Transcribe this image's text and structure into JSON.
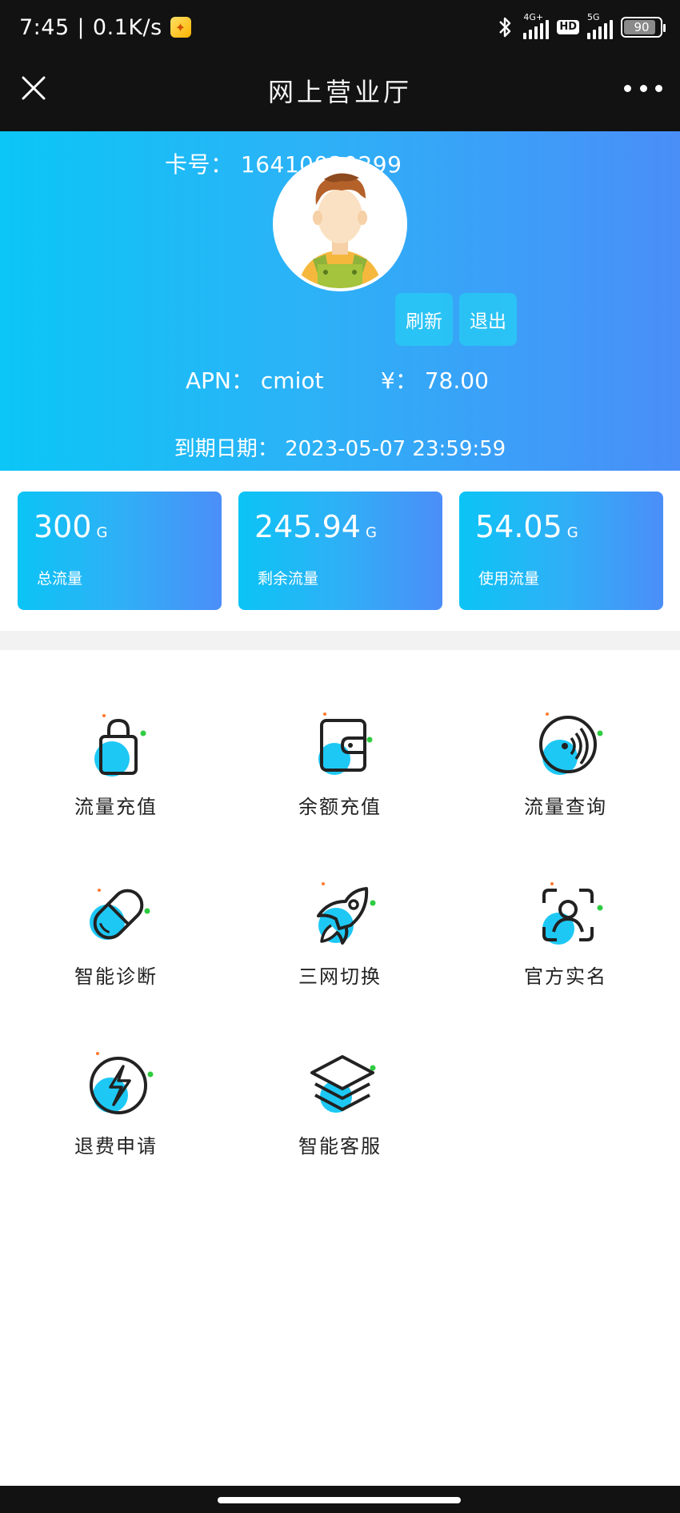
{
  "status_bar": {
    "time": "7:45",
    "speed": "0.1K/s",
    "network_1": "4G+",
    "network_2": "5G",
    "hd": "HD",
    "battery": "90",
    "battery_level": 0.9
  },
  "header": {
    "title": "网上营业厅",
    "close_icon": "close-icon",
    "more_icon": "more-icon"
  },
  "profile": {
    "card_label": "卡号：",
    "card_number": "16410030299",
    "refresh_label": "刷新",
    "logout_label": "退出",
    "apn_label": "APN：",
    "apn_value": "cmiot",
    "balance_label": "¥：",
    "balance_value": "78.00",
    "expire_label": "到期日期：",
    "expire_value": "2023-05-07 23:59:59"
  },
  "stats": [
    {
      "value": "300",
      "unit": "G",
      "label": "总流量"
    },
    {
      "value": "245.94",
      "unit": "G",
      "label": "剩余流量"
    },
    {
      "value": "54.05",
      "unit": "G",
      "label": "使用流量"
    }
  ],
  "menu": [
    {
      "label": "流量充值",
      "icon": "shopping-bag-icon"
    },
    {
      "label": "余额充值",
      "icon": "wallet-icon"
    },
    {
      "label": "流量查询",
      "icon": "signal-waves-icon"
    },
    {
      "label": "智能诊断",
      "icon": "pill-capsule-icon"
    },
    {
      "label": "三网切换",
      "icon": "rocket-icon"
    },
    {
      "label": "官方实名",
      "icon": "face-scan-icon"
    },
    {
      "label": "退费申请",
      "icon": "lightning-icon"
    },
    {
      "label": "智能客服",
      "icon": "layers-icon"
    }
  ],
  "colors": {
    "accent_blue": "#0bc6f6",
    "accent_indigo": "#4a8ef8",
    "icon_fill": "#1ec8f5",
    "icon_dot_green": "#2ecc40",
    "icon_dot_orange": "#ff7a2f",
    "dark_bar": "#121212"
  }
}
